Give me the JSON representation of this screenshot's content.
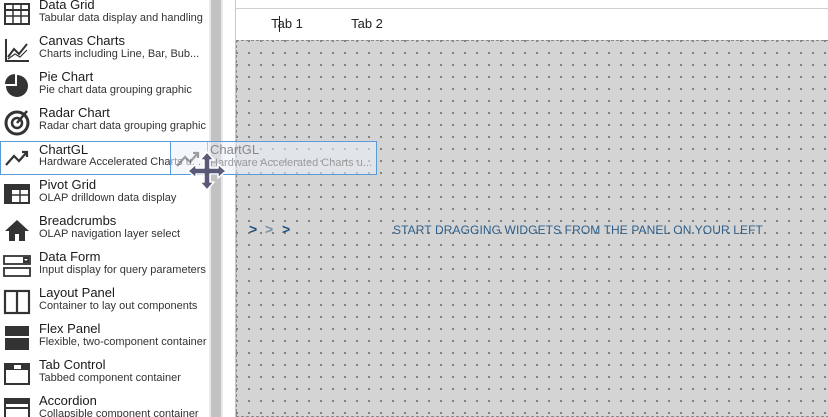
{
  "widgets": [
    {
      "title": "Data Grid",
      "desc": "Tabular data display and handling",
      "icon": "grid-icon"
    },
    {
      "title": "Canvas Charts",
      "desc": "Charts including Line, Bar, Bub...",
      "icon": "line-chart-icon"
    },
    {
      "title": "Pie Chart",
      "desc": "Pie chart data grouping graphic",
      "icon": "pie-chart-icon"
    },
    {
      "title": "Radar Chart",
      "desc": "Radar chart data grouping graphic",
      "icon": "radar-chart-icon"
    },
    {
      "title": "ChartGL",
      "desc": "Hardware Accelerated Charts u...",
      "icon": "trend-icon"
    },
    {
      "title": "Pivot Grid",
      "desc": "OLAP drilldown data display",
      "icon": "pivot-grid-icon"
    },
    {
      "title": "Breadcrumbs",
      "desc": "OLAP navigation layer select",
      "icon": "home-icon"
    },
    {
      "title": "Data Form",
      "desc": "Input display for query parameters",
      "icon": "form-icon"
    },
    {
      "title": "Layout Panel",
      "desc": "Container to lay out components",
      "icon": "layout-panel-icon"
    },
    {
      "title": "Flex Panel",
      "desc": "Flexible, two-component container",
      "icon": "flex-panel-icon"
    },
    {
      "title": "Tab Control",
      "desc": "Tabbed component container",
      "icon": "tab-control-icon"
    },
    {
      "title": "Accordion",
      "desc": "Collapsible component container",
      "icon": "accordion-icon"
    }
  ],
  "selected_widget_index": 4,
  "drag_ghost": {
    "title": "ChartGL",
    "desc": "Hardware Accelerated Charts u..."
  },
  "tabs": [
    {
      "label": "Tab 1",
      "active": true
    },
    {
      "label": "Tab 2",
      "active": false
    }
  ],
  "canvas": {
    "hint": "START DRAGGING WIDGETS FROM THE PANEL ON YOUR LEFT",
    "chevrons": [
      ">",
      ">",
      ">"
    ]
  },
  "colors": {
    "accent": "#2f7fd0",
    "hint_text": "#2e5f8a",
    "chevron_dark": "#1f4f7a",
    "chevron_light": "#7a8fa3",
    "canvas_bg": "#d4d4d4"
  }
}
